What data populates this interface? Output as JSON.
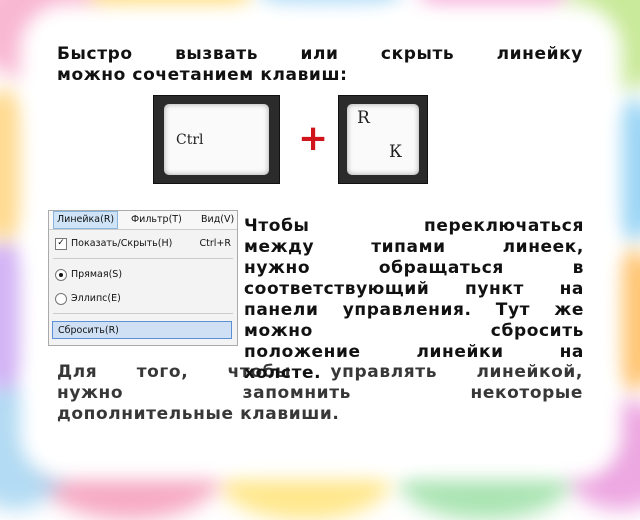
{
  "intro": {
    "line1": "Быстро вызвать или скрыть линейку",
    "line2": "можно сочетанием клавиш:"
  },
  "keys": {
    "ctrl_label": "Ctrl",
    "plus": "+",
    "r_label": "R",
    "k_label": "К"
  },
  "menu": {
    "bar": [
      "Линейка(R)",
      "Фильтр(T)",
      "Вид(V)"
    ],
    "show_hide": "Показать/Скрыть(H)",
    "show_hide_shortcut": "Ctrl+R",
    "straight": "Прямая(S)",
    "ellipse": "Эллипс(E)",
    "reset": "Сбросить(R)"
  },
  "explain": {
    "lines": [
      "Чтобы переключаться",
      "между типами линеек,",
      "нужно обращаться в",
      "соответствующий пункт на",
      "панели управления. Тут же",
      "можно сбросить",
      "положение линейки на",
      "холсте."
    ]
  },
  "bottom": {
    "line1": "Для того, чтобы управлять линейкой,",
    "line2": "нужно запомнить некоторые",
    "line3": "дополнительные клавиши."
  },
  "colors": {
    "plus": "#d0141c",
    "menu_highlight": "#cfe0f5"
  }
}
